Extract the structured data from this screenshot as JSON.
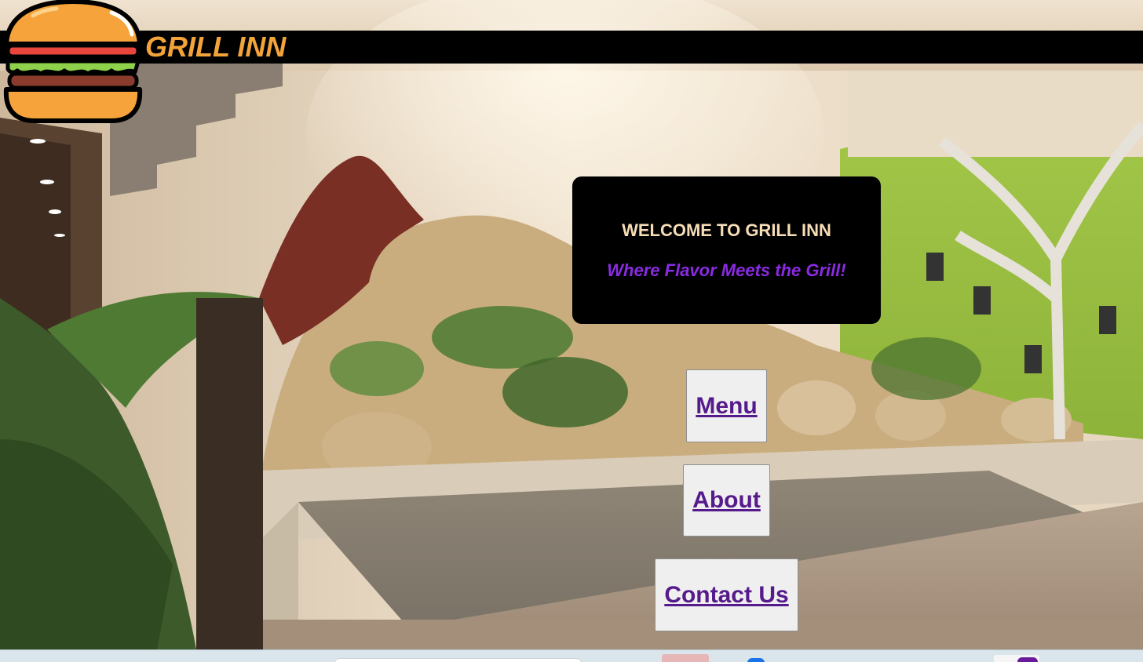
{
  "header": {
    "title": "GRILL INN",
    "logo_icon": "burger-icon"
  },
  "welcome": {
    "heading": "WELCOME TO GRILL INN",
    "tagline": "Where Flavor Meets the Grill!"
  },
  "nav": {
    "menu_label": "Menu",
    "about_label": "About",
    "contact_label": "Contact Us"
  },
  "colors": {
    "title": "#f2a33a",
    "header_bar": "#000000",
    "heading": "#f7ddb6",
    "tagline": "#8a2be2",
    "link": "#551a8b",
    "button_bg": "#efefef"
  },
  "taskbar": {
    "search_icon": "search-box",
    "apps": [
      "app-icon",
      "app-icon",
      "app-icon"
    ]
  }
}
